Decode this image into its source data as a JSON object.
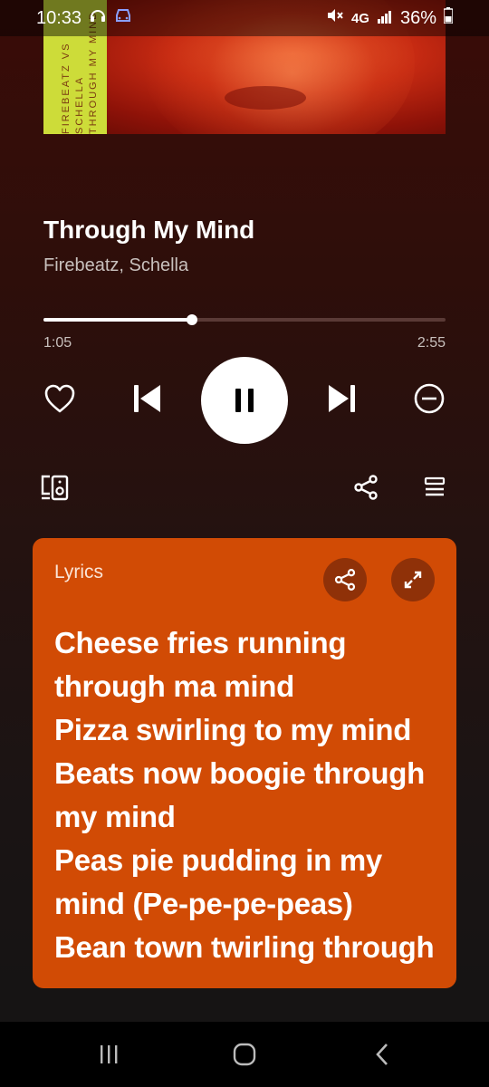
{
  "status_bar": {
    "time": "10:33",
    "network": "4G",
    "battery": "36%"
  },
  "album_art": {
    "artist_text": "FIREBEATZ VS SCHELLA",
    "title_text": "THROUGH MY MIND"
  },
  "track": {
    "title": "Through My Mind",
    "artist": "Firebeatz, Schella"
  },
  "progress": {
    "current": "1:05",
    "total": "2:55",
    "fraction": 0.37
  },
  "lyrics": {
    "label": "Lyrics",
    "lines": [
      "Cheese fries running",
      "through ma mind",
      "Pizza swirling to my mind",
      "Beats now boogie through",
      "my mind",
      "Peas pie pudding in my",
      "mind (Pe-pe-pe-peas)",
      "Bean town twirling through"
    ]
  },
  "colors": {
    "lyrics_card": "#d14b05",
    "accent": "#ffffff"
  },
  "icons": {
    "heart": "heart-icon",
    "previous": "skip-previous-icon",
    "pause": "pause-icon",
    "next": "skip-next-icon",
    "remove": "minus-circle-icon",
    "devices": "connect-device-icon",
    "share": "share-icon",
    "queue": "queue-icon",
    "expand": "expand-icon"
  }
}
